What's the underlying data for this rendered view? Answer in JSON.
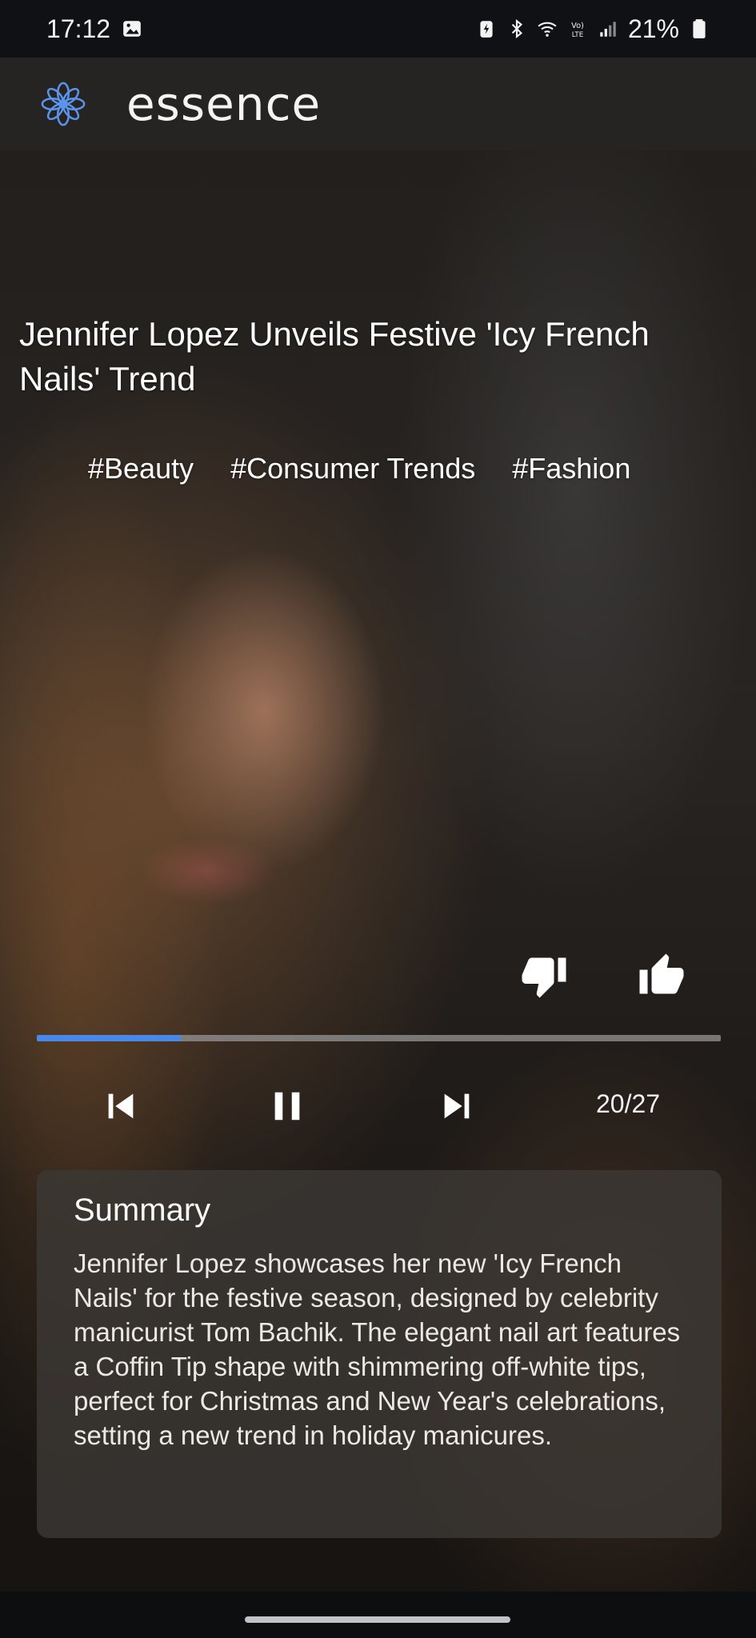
{
  "status_bar": {
    "time": "17:12",
    "battery_percent": "21%",
    "icons": [
      "gallery-icon",
      "battery-saver-icon",
      "bluetooth-icon",
      "wifi-icon",
      "volte-icon",
      "signal-icon",
      "battery-icon"
    ]
  },
  "app_bar": {
    "title": "essence",
    "logo_icon": "flower-logo-icon",
    "logo_color": "#4a88e8"
  },
  "article": {
    "title": "Jennifer Lopez Unveils Festive 'Icy French Nails' Trend",
    "tags": [
      "#Beauty",
      "#Consumer Trends",
      "#Fashion"
    ]
  },
  "reactions": {
    "dislike_icon": "thumbs-down-icon",
    "like_icon": "thumbs-up-icon"
  },
  "player": {
    "progress": 0.21,
    "progress_color": "#4a88e8",
    "counter": "20/27",
    "controls": [
      "skip-previous-icon",
      "pause-icon",
      "skip-next-icon"
    ]
  },
  "summary": {
    "title": "Summary",
    "text": "Jennifer Lopez showcases her new 'Icy French Nails' for the festive season, designed by celebrity manicurist Tom Bachik. The elegant nail art features a Coffin Tip shape with shimmering off-white tips, perfect for Christmas and New Year's celebrations, setting a new trend in holiday manicures."
  }
}
